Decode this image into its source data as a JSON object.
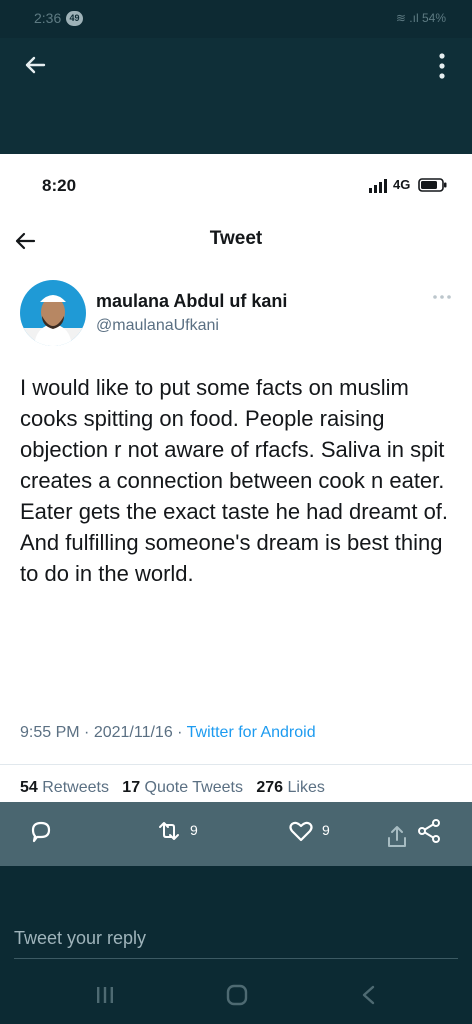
{
  "outer_status": {
    "time": "2:36",
    "notification_count": "49",
    "battery": "54%"
  },
  "inner_status": {
    "time": "8:20",
    "network": "4G"
  },
  "header": {
    "title": "Tweet"
  },
  "author": {
    "name": "maulana Abdul uf kani",
    "handle": "@maulanaUfkani"
  },
  "tweet": {
    "text": "I would like to put some facts on muslim cooks spitting on food. People raising objection r not aware of rfacfs. Saliva in spit creates a connection between cook n eater. Eater gets the exact taste he had dreamt of. And fulfilling someone's dream is best thing to do in the world.",
    "time": "9:55 PM",
    "separator": "·",
    "date": "2021/11/16",
    "client": "Twitter for Android"
  },
  "stats": {
    "retweets_count": "54",
    "retweets_label": "Retweets",
    "quotes_count": "17",
    "quotes_label": "Quote Tweets",
    "likes_count": "276",
    "likes_label": "Likes"
  },
  "actions": {
    "retweet_count": "9",
    "like_count": "9"
  },
  "reply": {
    "placeholder": "Tweet your reply"
  },
  "colors": {
    "link": "#1d9bf0",
    "outer_bg": "#0d2a33",
    "action_bar": "#4a6670"
  }
}
